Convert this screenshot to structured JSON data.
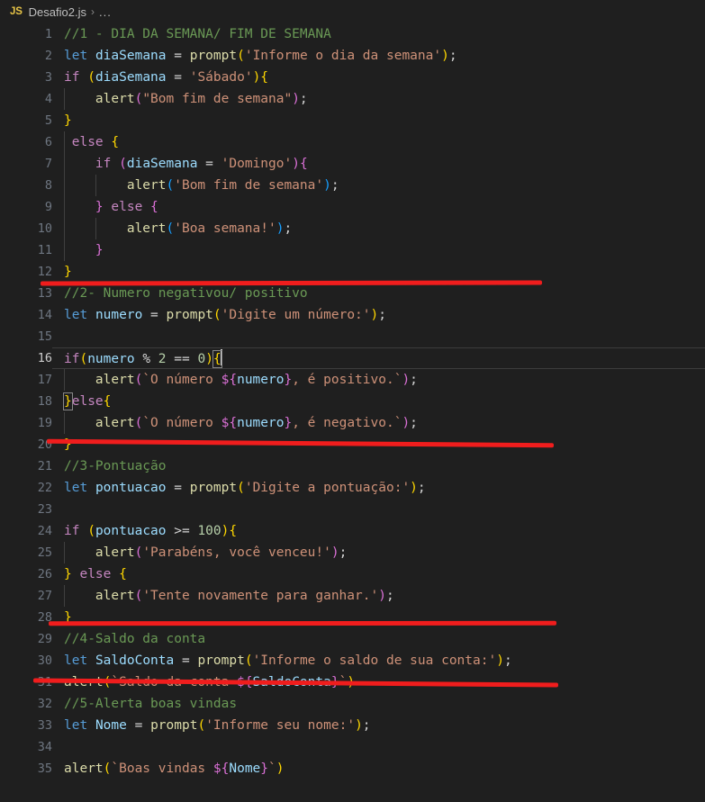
{
  "breadcrumb": {
    "language_badge": "JS",
    "file_name": "Desafio2.js",
    "separator": "›",
    "overflow": "..."
  },
  "editor": {
    "language": "javascript",
    "active_line": 16,
    "total_lines": 35,
    "theme_background": "#1f1f1f",
    "colors": {
      "comment": "#6a9955",
      "keyword": "#569cd6",
      "control": "#c586c0",
      "variable": "#9cdcfe",
      "function": "#dcdcaa",
      "string": "#ce9178",
      "number": "#b5cea8",
      "bracket_level_1": "#ffd700",
      "bracket_level_2": "#da70d6",
      "bracket_level_3": "#179fff",
      "line_number": "#6e7681",
      "line_number_active": "#cccccc",
      "annotation_red": "#f01d1d"
    },
    "lines": [
      {
        "n": "1",
        "text": "//1 - DIA DA SEMANA/ FIM DE SEMANA"
      },
      {
        "n": "2",
        "text": "let diaSemana = prompt('Informe o dia da semana');"
      },
      {
        "n": "3",
        "text": "if (diaSemana = 'Sábado'){"
      },
      {
        "n": "4",
        "text": "    alert(\"Bom fim de semana\");"
      },
      {
        "n": "5",
        "text": "}"
      },
      {
        "n": "6",
        "text": " else {"
      },
      {
        "n": "7",
        "text": "    if (diaSemana = 'Domingo'){"
      },
      {
        "n": "8",
        "text": "        alert('Bom fim de semana');"
      },
      {
        "n": "9",
        "text": "    } else {"
      },
      {
        "n": "10",
        "text": "        alert('Boa semana!');"
      },
      {
        "n": "11",
        "text": "    }"
      },
      {
        "n": "12",
        "text": "}"
      },
      {
        "n": "13",
        "text": "//2- Numero negativou/ positivo"
      },
      {
        "n": "14",
        "text": "let numero = prompt('Digite um número:');"
      },
      {
        "n": "15",
        "text": ""
      },
      {
        "n": "16",
        "text": "if(numero % 2 == 0){"
      },
      {
        "n": "17",
        "text": "    alert(`O número ${numero}, é positivo.`);"
      },
      {
        "n": "18",
        "text": "}else{"
      },
      {
        "n": "19",
        "text": "    alert(`O número ${numero}, é negativo.`);"
      },
      {
        "n": "20",
        "text": "}"
      },
      {
        "n": "21",
        "text": "//3-Pontuação"
      },
      {
        "n": "22",
        "text": "let pontuacao = prompt('Digite a pontuação:');"
      },
      {
        "n": "23",
        "text": ""
      },
      {
        "n": "24",
        "text": "if (pontuacao >= 100){"
      },
      {
        "n": "25",
        "text": "    alert('Parabéns, você venceu!');"
      },
      {
        "n": "26",
        "text": "} else {"
      },
      {
        "n": "27",
        "text": "    alert('Tente novamente para ganhar.');"
      },
      {
        "n": "28",
        "text": "}"
      },
      {
        "n": "29",
        "text": "//4-Saldo da conta"
      },
      {
        "n": "30",
        "text": "let SaldoConta = prompt('Informe o saldo de sua conta:');"
      },
      {
        "n": "31",
        "text": "alert(`Saldo da conta ${SaldoConta}`)"
      },
      {
        "n": "32",
        "text": "//5-Alerta boas vindas"
      },
      {
        "n": "33",
        "text": "let Nome = prompt('Informe seu nome:');"
      },
      {
        "n": "34",
        "text": ""
      },
      {
        "n": "35",
        "text": "alert(`Boas vindas ${Nome}`)"
      }
    ],
    "annotations": [
      {
        "label": "red-underline-after-line-12",
        "after_line": "12"
      },
      {
        "label": "red-underline-after-line-20",
        "after_line": "20"
      },
      {
        "label": "red-underline-after-line-28",
        "after_line": "28"
      },
      {
        "label": "red-underline-after-line-31",
        "after_line": "31"
      }
    ]
  }
}
